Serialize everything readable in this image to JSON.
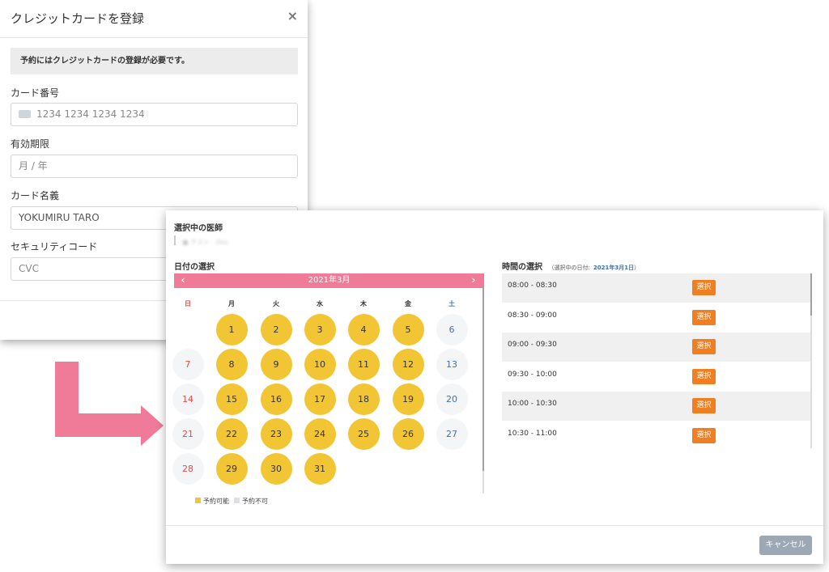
{
  "card_modal": {
    "title": "クレジットカードを登録",
    "close_glyph": "×",
    "notice": "予約にはクレジットカードの登録が必要です。",
    "fields": {
      "number_label": "カード番号",
      "number_placeholder": "1234 1234 1234 1234",
      "expiry_label": "有効期限",
      "expiry_placeholder": "月 / 年",
      "name_label": "カード名義",
      "name_value": "YOKUMIRU TARO",
      "cvc_label": "セキュリティコード",
      "cvc_placeholder": "CVC"
    }
  },
  "reservation": {
    "doctor_section_label": "選択中の医師",
    "doctor_name": "■ テスト　Doc",
    "date_section_label": "日付の選択",
    "month_label": "2021年3月",
    "prev_glyph": "‹",
    "next_glyph": "›",
    "weekdays": [
      "日",
      "月",
      "火",
      "水",
      "木",
      "金",
      "土"
    ],
    "weeks": [
      [
        null,
        1,
        2,
        3,
        4,
        5,
        6
      ],
      [
        7,
        8,
        9,
        10,
        11,
        12,
        13
      ],
      [
        14,
        15,
        16,
        17,
        18,
        19,
        20
      ],
      [
        21,
        22,
        23,
        24,
        25,
        26,
        27
      ],
      [
        28,
        29,
        30,
        31,
        null,
        null,
        null
      ]
    ],
    "legend": {
      "available": "予約可能",
      "unavailable": "予約不可"
    },
    "time_section_label": "時間の選択",
    "selected_date_prefix": "（選択中の日付:",
    "selected_date": "2021年3月1日",
    "selected_date_suffix": "）",
    "time_slots": [
      {
        "time": "08:00 - 08:30",
        "button": "選択"
      },
      {
        "time": "08:30 - 09:00",
        "button": "選択"
      },
      {
        "time": "09:00 - 09:30",
        "button": "選択"
      },
      {
        "time": "09:30 - 10:00",
        "button": "選択"
      },
      {
        "time": "10:00 - 10:30",
        "button": "選択"
      },
      {
        "time": "10:30 - 11:00",
        "button": "選択"
      }
    ],
    "cancel_label": "キャンセル"
  },
  "colors": {
    "calendar_header": "#f07b99",
    "available_day": "#f1c534",
    "unavailable_day": "#f4f5f7",
    "sunday_text": "#e04b4b",
    "saturday_text": "#4a6fa5",
    "select_button": "#f07f22",
    "cancel_button": "#9da8b5",
    "arrow": "#f07b99"
  },
  "icons": {
    "close": "close-icon",
    "card": "credit-card-icon",
    "prev": "chevron-left-icon",
    "next": "chevron-right-icon",
    "flow_arrow": "arrow-right-icon"
  }
}
